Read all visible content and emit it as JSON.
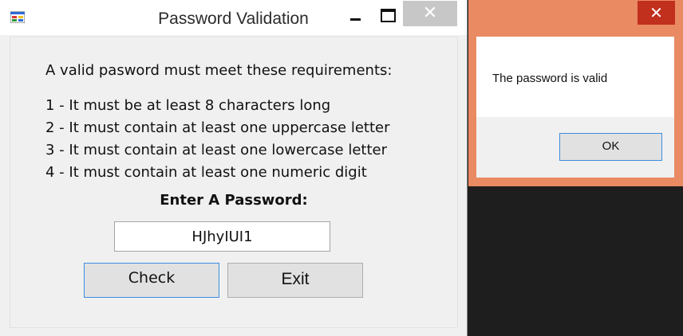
{
  "main_window": {
    "title": "Password Validation",
    "close_glyph": "✕",
    "requirements_header": "A valid pasword must meet these requirements:",
    "requirements": [
      "1 - It must be at least 8 characters long",
      "2 - It must contain at least one uppercase letter",
      "3 - It must contain at least one lowercase letter",
      "4 - It must contain at least one numeric digit"
    ],
    "enter_label": "Enter A Password:",
    "password_value": "HJhyIUI1",
    "check_label": "Check",
    "exit_label": "Exit",
    "icons": [
      "app-icon",
      "minimize-icon",
      "maximize-icon",
      "close-icon"
    ]
  },
  "message_box": {
    "text": "The password is valid",
    "ok_label": "OK",
    "close_glyph": "✕",
    "accent_color": "#e98a62",
    "close_color": "#c1301c"
  }
}
